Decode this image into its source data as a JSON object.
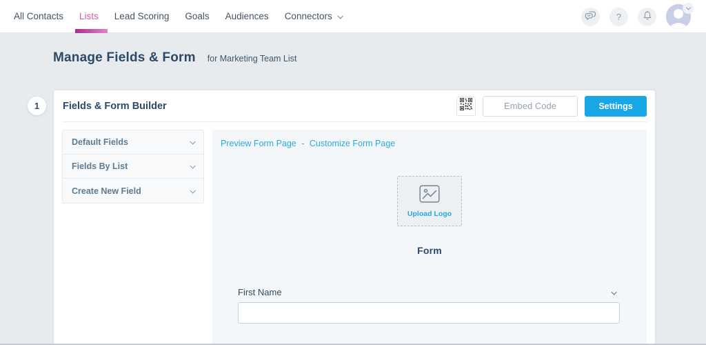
{
  "topnav": {
    "items": [
      {
        "label": "All Contacts",
        "active": false
      },
      {
        "label": "Lists",
        "active": true
      },
      {
        "label": "Lead Scoring",
        "active": false
      },
      {
        "label": "Goals",
        "active": false
      },
      {
        "label": "Audiences",
        "active": false
      },
      {
        "label": "Connectors",
        "active": false,
        "has_dropdown": true
      }
    ],
    "help_label": "?",
    "icons": [
      "chat-icon",
      "help-icon",
      "notifications-icon",
      "avatar"
    ]
  },
  "page_header": {
    "title": "Manage Fields & Form",
    "subtitle": "for Marketing Team List"
  },
  "builder": {
    "step": "1",
    "title": "Fields & Form Builder",
    "embed_button": "Embed Code",
    "settings_button": "Settings",
    "qr_icon": "qr-code-icon"
  },
  "field_panels": {
    "items": [
      {
        "label": "Default Fields"
      },
      {
        "label": "Fields By List"
      },
      {
        "label": "Create New Field"
      }
    ]
  },
  "form_preview": {
    "preview_link": "Preview Form Page",
    "separator": "-",
    "customize_link": "Customize Form Page",
    "upload_logo": "Upload Logo",
    "form_title": "Form",
    "fields": [
      {
        "label": "First Name",
        "value": ""
      }
    ]
  },
  "colors": {
    "accent_blue": "#17a6e6",
    "accent_pink": "#d55ca9",
    "navy": "#2c4a67",
    "link_blue": "#2aa9e0",
    "underline_gradient_start": "#a92d8e",
    "underline_gradient_end": "#dd86c4"
  }
}
